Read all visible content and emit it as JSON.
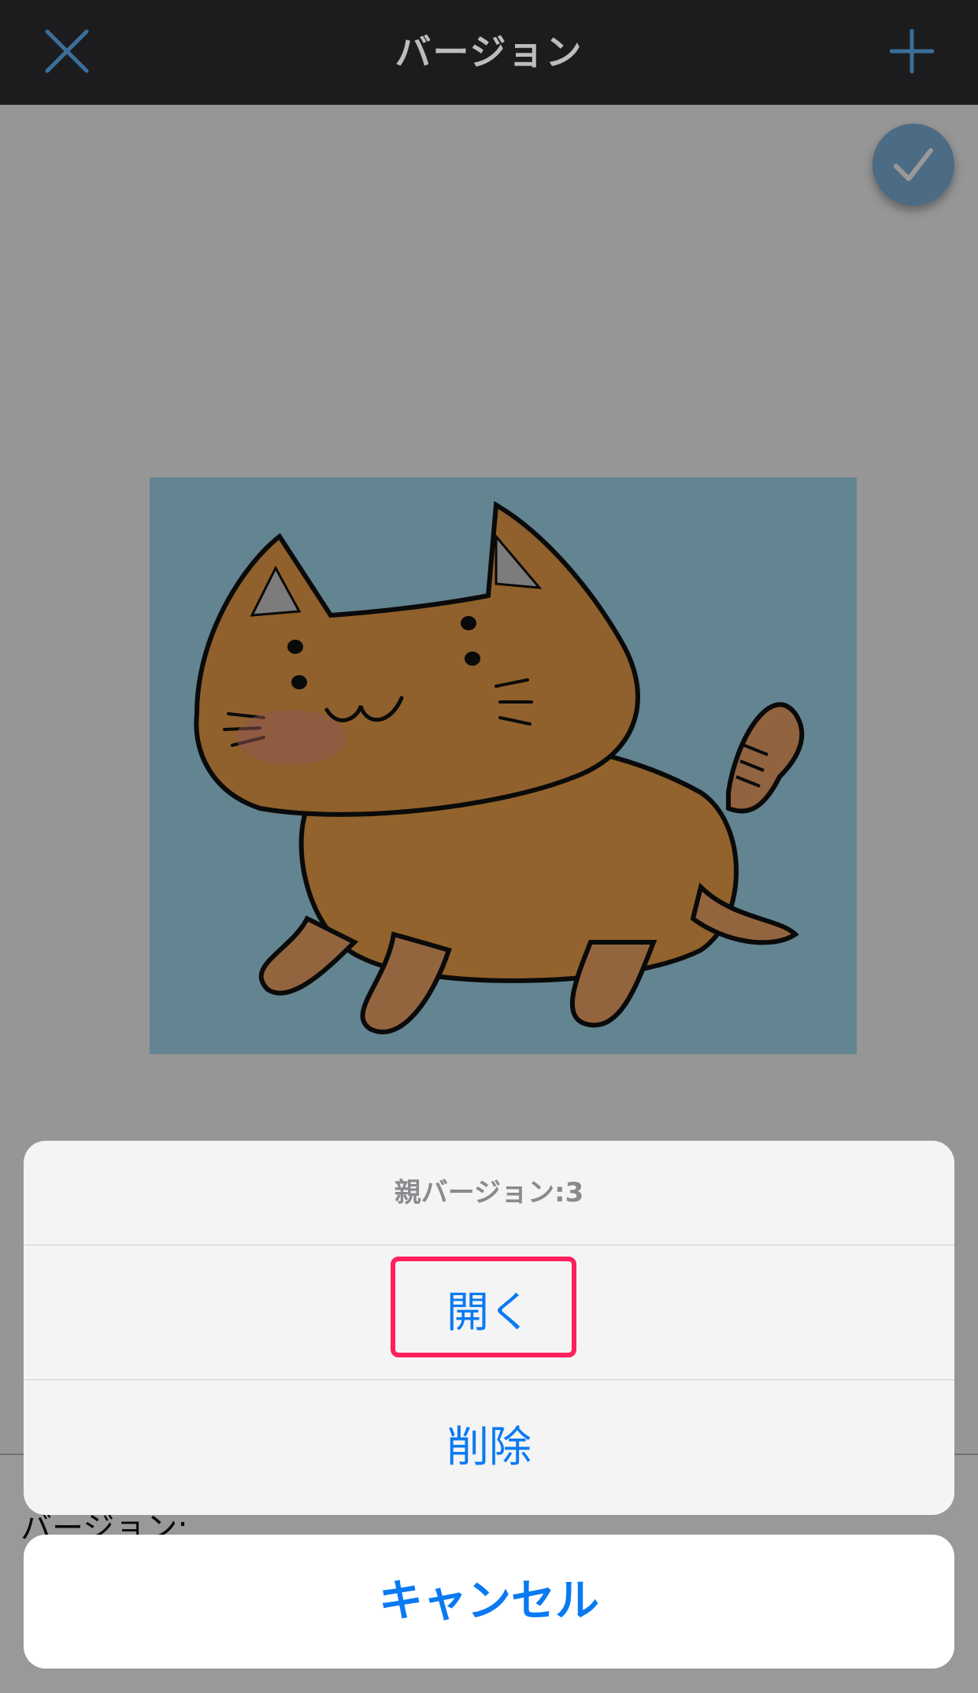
{
  "navbar": {
    "title": "バージョン",
    "close_icon": "close-icon",
    "add_icon": "plus-icon"
  },
  "preview": {
    "check_icon": "checkmark-icon"
  },
  "version_row": {
    "label": "バージョン:"
  },
  "action_sheet": {
    "title": "親バージョン:3",
    "actions": [
      {
        "label": "開く"
      },
      {
        "label": "削除"
      }
    ],
    "cancel_label": "キャンセル"
  },
  "colors": {
    "accent": "#0a7af2",
    "highlight": "#ff1f5e",
    "navbar_bg": "#1c1c1e",
    "card_bg": "#a6dcf2",
    "cat_body": "#f0a040"
  }
}
